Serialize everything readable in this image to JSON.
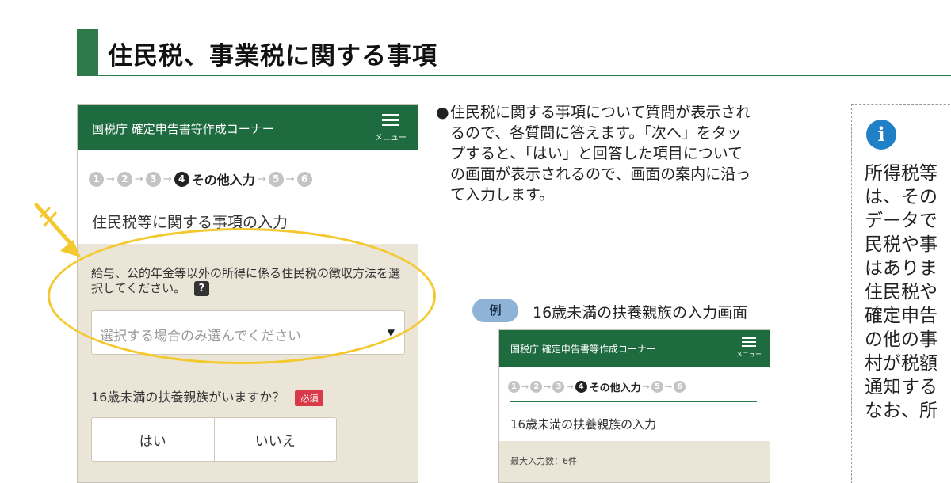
{
  "heading": {
    "title": "住民税、事業税に関する事項"
  },
  "phone": {
    "app_title": "国税庁 確定申告書等作成コーナー",
    "menu_label": "メニュー",
    "steps": [
      {
        "num": "1"
      },
      {
        "num": "2"
      },
      {
        "num": "3"
      },
      {
        "num": "4",
        "label": "その他入力"
      },
      {
        "num": "5"
      },
      {
        "num": "6"
      }
    ],
    "page_title": "住民税等に関する事項の入力",
    "question1": "給与、公的年金等以外の所得に係る住民税の徴収方法を選択してください。",
    "help_icon": "?",
    "select_placeholder": "選択する場合のみ選んでください",
    "question2": "16歳未満の扶養親族がいますか？",
    "required_badge": "必須",
    "option_yes": "はい",
    "option_no": "いいえ"
  },
  "explanation": {
    "bullet": "●",
    "text": "住民税に関する事項について質問が表示されるので、各質問に答えます。「次へ」をタップすると、「はい」と回答した項目についての画面が表示されるので、画面の案内に沿って入力します。"
  },
  "example": {
    "badge": "例",
    "caption": "16歳未満の扶養親族の入力画面",
    "app_title": "国税庁 確定申告書等作成コーナー",
    "menu_label": "メニュー",
    "page_title": "16歳未満の扶養親族の入力",
    "note": "最大入力数：6件"
  },
  "info": {
    "icon": "i",
    "lines": [
      "所得税等",
      "は、その",
      "データで",
      "民税や事",
      "はありま",
      "住民税や",
      "確定申告",
      "の他の事",
      "村が税額",
      "通知する",
      "なお、所"
    ]
  },
  "colors": {
    "header_green": "#1e6b40",
    "accent_green": "#2f7a4a",
    "beige": "#ebe5d8",
    "highlight_yellow": "#f4c82f",
    "required_red": "#d83a4a",
    "example_badge": "#8fb3d6",
    "info_blue": "#1f7fc7"
  },
  "icons": {
    "menu": "hamburger-icon",
    "help": "question-icon",
    "dropdown": "caret-down-icon",
    "info": "info-icon",
    "annotation": "arrow-annotation-icon"
  }
}
